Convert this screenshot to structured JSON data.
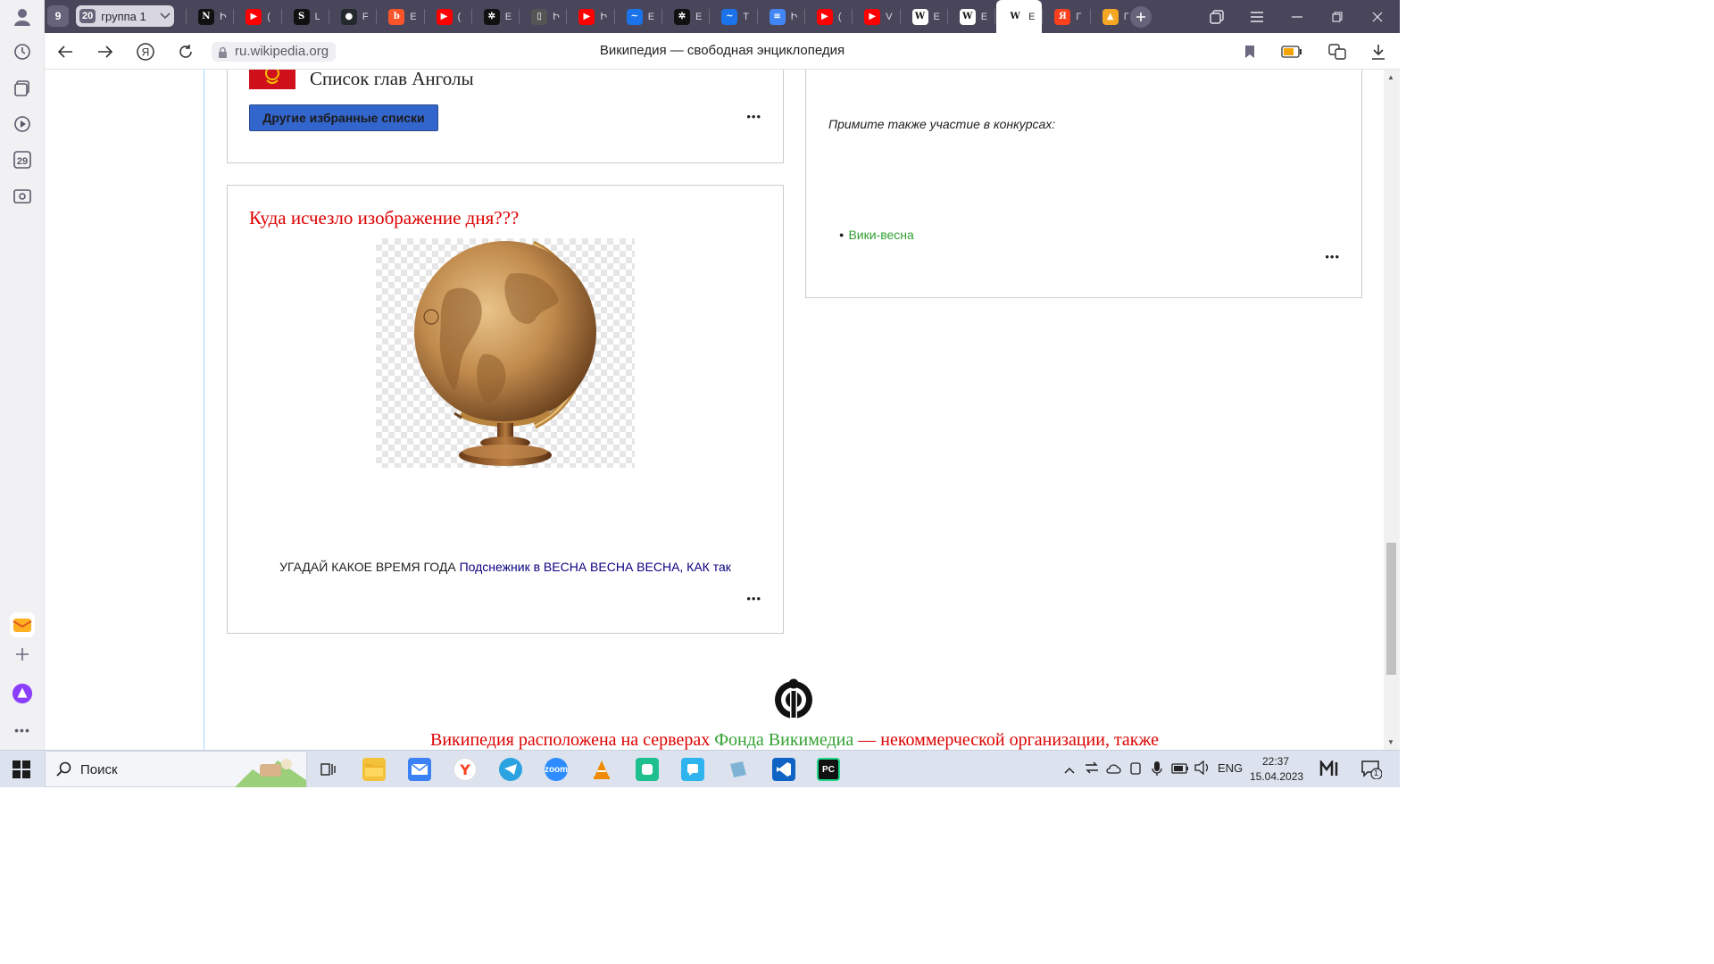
{
  "sidebar": {
    "items": [
      "history-icon",
      "collections-icon",
      "media-icon",
      "calendar-icon",
      "screenshot-icon"
    ],
    "calendar_day": "29"
  },
  "tabs": {
    "count_badge": "9",
    "group_count": "20",
    "group_label": "группа 1",
    "items": [
      {
        "icon": "notion-icon",
        "letter": "Ի",
        "color": "#111111",
        "glyph": "N"
      },
      {
        "icon": "youtube-icon",
        "letter": "(",
        "color": "#ff0000",
        "glyph": "▶"
      },
      {
        "icon": "slack-like-icon",
        "letter": "L",
        "color": "#111111",
        "glyph": "S"
      },
      {
        "icon": "github-icon",
        "letter": "F",
        "color": "#24292e",
        "glyph": "●"
      },
      {
        "icon": "brave-icon",
        "letter": "E",
        "color": "#fb542b",
        "glyph": "b"
      },
      {
        "icon": "youtube-icon",
        "letter": "(",
        "color": "#ff0000",
        "glyph": "▶"
      },
      {
        "icon": "openai-icon",
        "letter": "E",
        "color": "#111111",
        "glyph": "✲"
      },
      {
        "icon": "document-icon",
        "letter": "Ի",
        "color": "#555555",
        "glyph": "▯"
      },
      {
        "icon": "youtube-icon",
        "letter": "Ի",
        "color": "#ff0000",
        "glyph": "▶"
      },
      {
        "icon": "edge-icon",
        "letter": "E",
        "color": "#1a73e8",
        "glyph": "~"
      },
      {
        "icon": "openai-icon",
        "letter": "E",
        "color": "#111111",
        "glyph": "✲"
      },
      {
        "icon": "edge-icon",
        "letter": "T",
        "color": "#1a73e8",
        "glyph": "~"
      },
      {
        "icon": "docs-icon",
        "letter": "Ի",
        "color": "#4285f4",
        "glyph": "≡"
      },
      {
        "icon": "youtube-icon",
        "letter": "(",
        "color": "#ff0000",
        "glyph": "▶"
      },
      {
        "icon": "youtube-icon",
        "letter": "V",
        "color": "#ff0000",
        "glyph": "▶"
      },
      {
        "icon": "wikipedia-icon",
        "letter": "E",
        "color": "#ffffff",
        "glyph": "W"
      },
      {
        "icon": "wikipedia-icon",
        "letter": "E",
        "color": "#ffffff",
        "glyph": "W"
      },
      {
        "icon": "wikipedia-icon",
        "letter": "E",
        "color": "#ffffff",
        "glyph": "W",
        "active": true
      },
      {
        "icon": "yandex-icon",
        "letter": "Г",
        "color": "#fc3f1d",
        "glyph": "Я"
      },
      {
        "icon": "image-icon",
        "letter": "Г",
        "color": "#f5a623",
        "glyph": "▲"
      }
    ]
  },
  "nav": {
    "url": "ru.wikipedia.org",
    "title": "Википедия — свободная энциклопедия"
  },
  "page": {
    "featured_list_title": "Список глав Анголы",
    "other_lists_button": "Другие избранные списки",
    "more": "•••",
    "image_of_day_heading": "Куда исчезло изображение дня???",
    "caption_plain": "УГАДАЙ КАКОЕ ВРЕМЯ ГОДА ",
    "caption_link1": "Подснежник",
    "caption_mid": " в ",
    "caption_link2": "ВЕСНА ВЕСНА ВЕСНА, КАК так",
    "contests_intro": "Примите также участие в конкурсах:",
    "contest_link": "Вики-весна",
    "footer_pre": "Википедия расположена на серверах ",
    "footer_link": "Фонда Викимедиа",
    "footer_post": " — некоммерческой организации, также",
    "colors": {
      "red": "#dd0000",
      "link": "#0b0080",
      "green": "#33a033",
      "button": "#3366cc"
    }
  },
  "taskbar": {
    "search": "Поиск",
    "lang": "ENG",
    "time": "22:37",
    "date": "15.04.2023",
    "notifications": "1"
  }
}
